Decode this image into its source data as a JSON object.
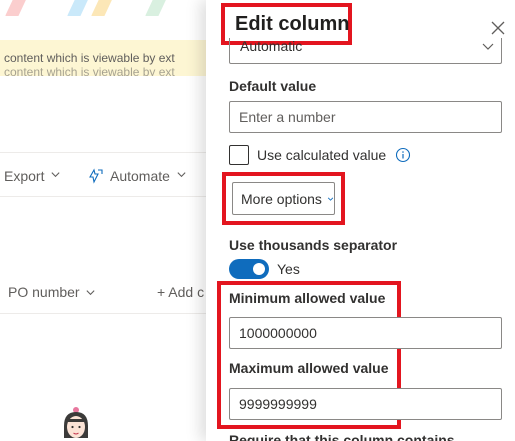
{
  "background": {
    "banner_line_1": "content which is viewable by ext",
    "banner_line_2": "content which is viewable by ext",
    "toolbar": {
      "export_label": "Export",
      "automate_label": "Automate"
    },
    "column_header": {
      "po_number_label": "PO number",
      "add_column_label": "+ Add c"
    }
  },
  "panel": {
    "title": "Edit column",
    "close_icon": "close-icon",
    "select": {
      "value": "Automatic",
      "icon": "chevron-down-icon"
    },
    "default_value": {
      "label": "Default value",
      "placeholder": "Enter a number",
      "value": ""
    },
    "calculated": {
      "label": "Use calculated value",
      "checked": false,
      "icon": "info-icon"
    },
    "more_options": {
      "label": "More options",
      "icon": "chevron-down-icon"
    },
    "thousands_separator": {
      "label": "Use thousands separator",
      "state_text": "Yes",
      "on": true
    },
    "minimum": {
      "label": "Minimum allowed value",
      "value": "1000000000"
    },
    "maximum": {
      "label": "Maximum allowed value",
      "value": "9999999999"
    },
    "require_label": "Require that this column contains"
  },
  "colors": {
    "accent": "#0f6cbd",
    "highlight": "#e3151f",
    "banner": "#fdf6d3"
  }
}
